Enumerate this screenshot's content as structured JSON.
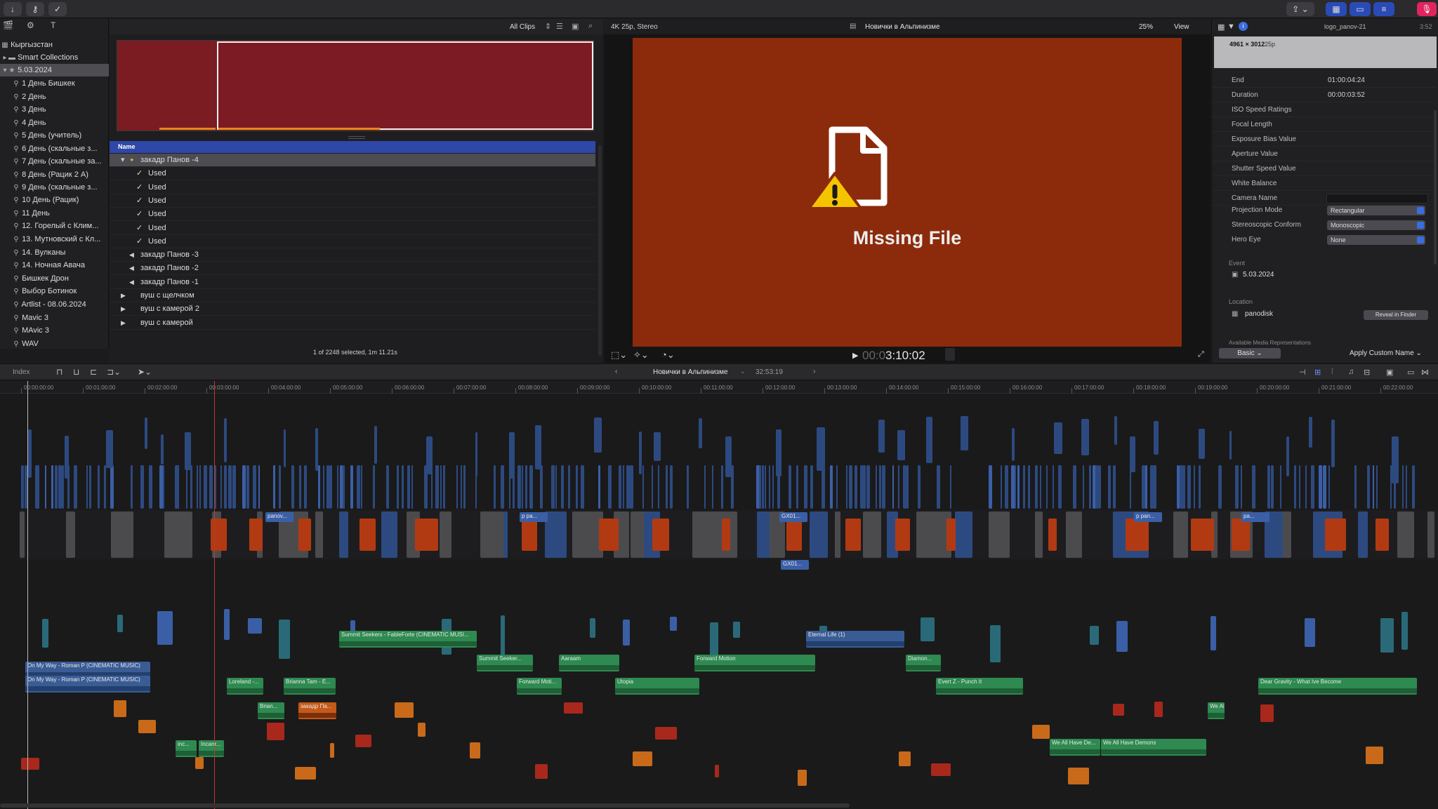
{
  "toolbar": {
    "import_icon": "download-arrow-icon",
    "keywords_icon": "key-icon",
    "background_tasks_icon": "check-circle-icon",
    "colors": {
      "record_button": "#e0245e"
    }
  },
  "sidebar": {
    "items": [
      {
        "label": "Кыргызстан",
        "type": "library"
      },
      {
        "label": "Smart Collections",
        "type": "folder"
      },
      {
        "label": "5.03.2024",
        "type": "event",
        "selected": true
      },
      {
        "label": "1 День Бишкек",
        "type": "keyword"
      },
      {
        "label": "2 День",
        "type": "keyword"
      },
      {
        "label": "3 День",
        "type": "keyword"
      },
      {
        "label": "4 День",
        "type": "keyword"
      },
      {
        "label": "5 День (учитель)",
        "type": "keyword"
      },
      {
        "label": "6 День  (скальные з...",
        "type": "keyword"
      },
      {
        "label": "7 День (скальные за...",
        "type": "keyword"
      },
      {
        "label": "8 День (Рацик 2 А)",
        "type": "keyword"
      },
      {
        "label": "9 День (скальные з...",
        "type": "keyword"
      },
      {
        "label": "10 День  (Рацик)",
        "type": "keyword"
      },
      {
        "label": "11 День",
        "type": "keyword"
      },
      {
        "label": "12. Горелый с Клим...",
        "type": "keyword"
      },
      {
        "label": "13. Мутновский с Кл...",
        "type": "keyword"
      },
      {
        "label": "14. Вулканы",
        "type": "keyword"
      },
      {
        "label": "14. Ночная Авача",
        "type": "keyword"
      },
      {
        "label": "Бишкек  Дрон",
        "type": "keyword"
      },
      {
        "label": "Выбор Ботинок",
        "type": "keyword"
      },
      {
        "label": "Artlist - 08.06.2024",
        "type": "keyword"
      },
      {
        "label": "Mavic 3",
        "type": "keyword"
      },
      {
        "label": "MAvic 3",
        "type": "keyword"
      },
      {
        "label": "WAV",
        "type": "keyword"
      }
    ]
  },
  "browser": {
    "filter_label": "All Clips",
    "column_header": "Name",
    "rows": [
      {
        "label": "закадр Панов -4",
        "indent": 1,
        "expanded": true,
        "selected": true
      },
      {
        "label": "Used",
        "indent": 2,
        "check": true
      },
      {
        "label": "Used",
        "indent": 2,
        "check": true
      },
      {
        "label": "Used",
        "indent": 2,
        "check": true
      },
      {
        "label": "Used",
        "indent": 2,
        "check": true
      },
      {
        "label": "Used",
        "indent": 2,
        "check": true
      },
      {
        "label": "Used",
        "indent": 2,
        "check": true
      },
      {
        "label": "закадр Панов -3",
        "indent": 1,
        "audio": true
      },
      {
        "label": "закадр Панов -2",
        "indent": 1,
        "audio": true
      },
      {
        "label": "закадр Панов -1",
        "indent": 1,
        "audio": true
      },
      {
        "label": "вуш с щелчком",
        "indent": 1,
        "expandable": true
      },
      {
        "label": "вуш с камерой 2",
        "indent": 1,
        "expandable": true
      },
      {
        "label": "вуш с камерой",
        "indent": 1,
        "expandable": true
      }
    ],
    "status": "1 of 2248 selected, 1m 11.21s"
  },
  "viewer": {
    "format": "4K 25p, Stereo",
    "title": "Новички в Альпинизме",
    "zoom": "25%",
    "view_label": "View",
    "missing_label": "Missing File",
    "timecode_dim": "00:0",
    "timecode": "3:10:02",
    "colors": {
      "missing_bg": "#8c2b0b"
    }
  },
  "inspector": {
    "clip_name": "logo_panov-21",
    "duration_corner": "3:52",
    "resolution": "4961 × 3012",
    "fps": "25p",
    "rows": [
      {
        "key": "End",
        "value": "01:00:04:24"
      },
      {
        "key": "Duration",
        "value": "00:00:03:52"
      },
      {
        "key": "ISO Speed Ratings",
        "value": ""
      },
      {
        "key": "Focal Length",
        "value": ""
      },
      {
        "key": "Exposure Bias Value",
        "value": ""
      },
      {
        "key": "Aperture Value",
        "value": ""
      },
      {
        "key": "Shutter Speed Value",
        "value": ""
      },
      {
        "key": "White Balance",
        "value": ""
      },
      {
        "key": "Camera Name",
        "value": ""
      }
    ],
    "popups": [
      {
        "key": "Projection Mode",
        "value": "Rectangular"
      },
      {
        "key": "Stereoscopic Conform",
        "value": "Monoscopic"
      },
      {
        "key": "Hero Eye",
        "value": "None"
      }
    ],
    "event_heading": "Event",
    "event_value": "5.03.2024",
    "location_heading": "Location",
    "location_value": "panodisk",
    "reveal_button": "Reveal in Finder",
    "available_heading": "Available Media Representations",
    "basic_button": "Basic",
    "apply_button": "Apply Custom Name"
  },
  "timeline_bar": {
    "index_label": "Index",
    "project_title": "Новички в Альпинизме",
    "project_duration": "32:53:19"
  },
  "timeline": {
    "ruler_ticks": [
      "00:00:00:00",
      "00:01:00:00",
      "00:02:00:00",
      "00:03:00:00",
      "00:04:00:00",
      "00:05:00:00",
      "00:06:00:00",
      "00:07:00:00",
      "00:08:00:00",
      "00:09:00:00",
      "00:10:00:00",
      "00:11:00:00",
      "00:12:00:00",
      "00:13:00:00",
      "00:14:00:00",
      "00:15:00:00",
      "00:16:00:00",
      "00:17:00:00",
      "00:18:00:00",
      "00:19:00:00",
      "00:20:00:00",
      "00:21:00:00",
      "00:22:00:00"
    ],
    "title_clips": [
      {
        "label": "panov..."
      },
      {
        "label": "p pa..."
      },
      {
        "label": "GX01..."
      },
      {
        "label": "GX01..."
      },
      {
        "label": "p pan..."
      },
      {
        "label": "pa..."
      }
    ],
    "audio_clips": [
      {
        "label": "Summit Seekers - FableForte (CINEMATIC MUSI..."
      },
      {
        "label": "Eternal Life (1)"
      },
      {
        "label": "On My Way - Roman P (CINEMATIC MUSIC)"
      },
      {
        "label": "On My Way - Roman P (CINEMATIC MUSIC)"
      },
      {
        "label": "Summit Seeker..."
      },
      {
        "label": "Aaraam"
      },
      {
        "label": "Forward Motion"
      },
      {
        "label": "Diamon..."
      },
      {
        "label": "Loreland -..."
      },
      {
        "label": "Brianna Tam - E..."
      },
      {
        "label": "Forward Moti..."
      },
      {
        "label": "Utopia"
      },
      {
        "label": "Evert Z - Punch It"
      },
      {
        "label": "Dear Gravity - What Ive Become"
      },
      {
        "label": "закадр Па..."
      },
      {
        "label": "Brian..."
      },
      {
        "label": "We All..."
      },
      {
        "label": "We All Have De..."
      },
      {
        "label": "We All Have Demons"
      },
      {
        "label": "Incanr..."
      },
      {
        "label": "inc..."
      }
    ]
  }
}
